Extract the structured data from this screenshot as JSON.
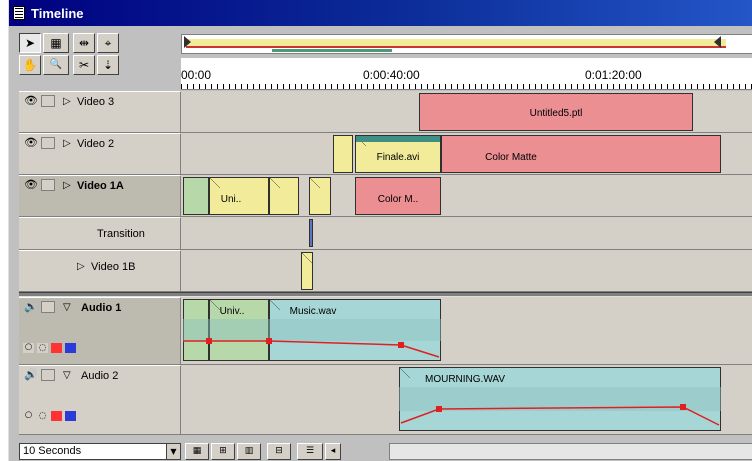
{
  "window": {
    "title": "Timeline"
  },
  "tools": [
    {
      "name": "selection-tool-icon",
      "glyph": "➤"
    },
    {
      "name": "track-select-tool-icon",
      "glyph": "▦"
    },
    {
      "name": "multitrack-tool-icon",
      "glyph": "⇹"
    },
    {
      "name": "link-tool-icon",
      "glyph": "⌖"
    },
    {
      "name": "hand-tool-icon",
      "glyph": "✋"
    },
    {
      "name": "zoom-tool-icon",
      "glyph": "🔍"
    },
    {
      "name": "razor-tool-icon",
      "glyph": "✂"
    },
    {
      "name": "in-out-tool-icon",
      "glyph": "⇣"
    }
  ],
  "ruler": {
    "labels": [
      "00:00",
      "0:00:40:00",
      "0:01:20:00"
    ]
  },
  "tracks": {
    "video3": {
      "label": "Video 3"
    },
    "video2": {
      "label": "Video 2"
    },
    "video1a": {
      "label": "Video 1A"
    },
    "transition": {
      "label": "Transition"
    },
    "video1b": {
      "label": "Video 1B"
    },
    "audio1": {
      "label": "Audio 1"
    },
    "audio2": {
      "label": "Audio 2"
    }
  },
  "clips": {
    "untitled": "Untitled5.ptl",
    "finale": "Finale.avi",
    "color_matte": "Color Matte",
    "uni": "Uni..",
    "color_m": "Color M..",
    "univ_audio": "Univ..",
    "music": "Music.wav",
    "mourning": "MOURNING.WAV"
  },
  "status": {
    "zoom_value": "10 Seconds",
    "zoom_arrow": "▼",
    "buttons": [
      "▦",
      "⊞",
      "▥",
      "⊟",
      "☰",
      "◂"
    ]
  },
  "colors": {
    "title_bar": "#000080",
    "video_clip": "#eb8f93",
    "still_clip": "#f2ec9a",
    "green_clip": "#b7d8a8",
    "audio_clip": "#a6d6d6",
    "volume_line": "#e02020"
  }
}
